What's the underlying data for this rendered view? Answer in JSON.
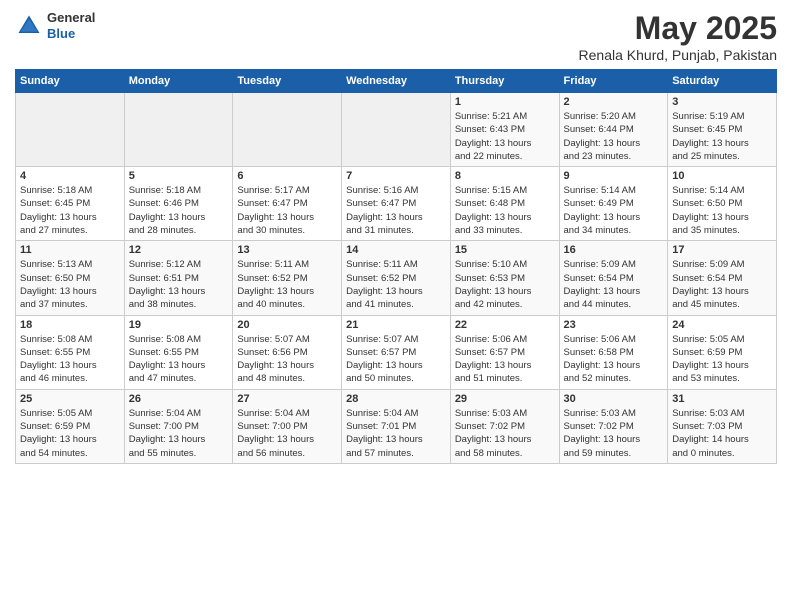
{
  "header": {
    "logo": {
      "line1": "General",
      "line2": "Blue"
    },
    "title": "May 2025",
    "subtitle": "Renala Khurd, Punjab, Pakistan"
  },
  "weekdays": [
    "Sunday",
    "Monday",
    "Tuesday",
    "Wednesday",
    "Thursday",
    "Friday",
    "Saturday"
  ],
  "weeks": [
    [
      {
        "day": "",
        "info": ""
      },
      {
        "day": "",
        "info": ""
      },
      {
        "day": "",
        "info": ""
      },
      {
        "day": "",
        "info": ""
      },
      {
        "day": "1",
        "info": "Sunrise: 5:21 AM\nSunset: 6:43 PM\nDaylight: 13 hours\nand 22 minutes."
      },
      {
        "day": "2",
        "info": "Sunrise: 5:20 AM\nSunset: 6:44 PM\nDaylight: 13 hours\nand 23 minutes."
      },
      {
        "day": "3",
        "info": "Sunrise: 5:19 AM\nSunset: 6:45 PM\nDaylight: 13 hours\nand 25 minutes."
      }
    ],
    [
      {
        "day": "4",
        "info": "Sunrise: 5:18 AM\nSunset: 6:45 PM\nDaylight: 13 hours\nand 27 minutes."
      },
      {
        "day": "5",
        "info": "Sunrise: 5:18 AM\nSunset: 6:46 PM\nDaylight: 13 hours\nand 28 minutes."
      },
      {
        "day": "6",
        "info": "Sunrise: 5:17 AM\nSunset: 6:47 PM\nDaylight: 13 hours\nand 30 minutes."
      },
      {
        "day": "7",
        "info": "Sunrise: 5:16 AM\nSunset: 6:47 PM\nDaylight: 13 hours\nand 31 minutes."
      },
      {
        "day": "8",
        "info": "Sunrise: 5:15 AM\nSunset: 6:48 PM\nDaylight: 13 hours\nand 33 minutes."
      },
      {
        "day": "9",
        "info": "Sunrise: 5:14 AM\nSunset: 6:49 PM\nDaylight: 13 hours\nand 34 minutes."
      },
      {
        "day": "10",
        "info": "Sunrise: 5:14 AM\nSunset: 6:50 PM\nDaylight: 13 hours\nand 35 minutes."
      }
    ],
    [
      {
        "day": "11",
        "info": "Sunrise: 5:13 AM\nSunset: 6:50 PM\nDaylight: 13 hours\nand 37 minutes."
      },
      {
        "day": "12",
        "info": "Sunrise: 5:12 AM\nSunset: 6:51 PM\nDaylight: 13 hours\nand 38 minutes."
      },
      {
        "day": "13",
        "info": "Sunrise: 5:11 AM\nSunset: 6:52 PM\nDaylight: 13 hours\nand 40 minutes."
      },
      {
        "day": "14",
        "info": "Sunrise: 5:11 AM\nSunset: 6:52 PM\nDaylight: 13 hours\nand 41 minutes."
      },
      {
        "day": "15",
        "info": "Sunrise: 5:10 AM\nSunset: 6:53 PM\nDaylight: 13 hours\nand 42 minutes."
      },
      {
        "day": "16",
        "info": "Sunrise: 5:09 AM\nSunset: 6:54 PM\nDaylight: 13 hours\nand 44 minutes."
      },
      {
        "day": "17",
        "info": "Sunrise: 5:09 AM\nSunset: 6:54 PM\nDaylight: 13 hours\nand 45 minutes."
      }
    ],
    [
      {
        "day": "18",
        "info": "Sunrise: 5:08 AM\nSunset: 6:55 PM\nDaylight: 13 hours\nand 46 minutes."
      },
      {
        "day": "19",
        "info": "Sunrise: 5:08 AM\nSunset: 6:55 PM\nDaylight: 13 hours\nand 47 minutes."
      },
      {
        "day": "20",
        "info": "Sunrise: 5:07 AM\nSunset: 6:56 PM\nDaylight: 13 hours\nand 48 minutes."
      },
      {
        "day": "21",
        "info": "Sunrise: 5:07 AM\nSunset: 6:57 PM\nDaylight: 13 hours\nand 50 minutes."
      },
      {
        "day": "22",
        "info": "Sunrise: 5:06 AM\nSunset: 6:57 PM\nDaylight: 13 hours\nand 51 minutes."
      },
      {
        "day": "23",
        "info": "Sunrise: 5:06 AM\nSunset: 6:58 PM\nDaylight: 13 hours\nand 52 minutes."
      },
      {
        "day": "24",
        "info": "Sunrise: 5:05 AM\nSunset: 6:59 PM\nDaylight: 13 hours\nand 53 minutes."
      }
    ],
    [
      {
        "day": "25",
        "info": "Sunrise: 5:05 AM\nSunset: 6:59 PM\nDaylight: 13 hours\nand 54 minutes."
      },
      {
        "day": "26",
        "info": "Sunrise: 5:04 AM\nSunset: 7:00 PM\nDaylight: 13 hours\nand 55 minutes."
      },
      {
        "day": "27",
        "info": "Sunrise: 5:04 AM\nSunset: 7:00 PM\nDaylight: 13 hours\nand 56 minutes."
      },
      {
        "day": "28",
        "info": "Sunrise: 5:04 AM\nSunset: 7:01 PM\nDaylight: 13 hours\nand 57 minutes."
      },
      {
        "day": "29",
        "info": "Sunrise: 5:03 AM\nSunset: 7:02 PM\nDaylight: 13 hours\nand 58 minutes."
      },
      {
        "day": "30",
        "info": "Sunrise: 5:03 AM\nSunset: 7:02 PM\nDaylight: 13 hours\nand 59 minutes."
      },
      {
        "day": "31",
        "info": "Sunrise: 5:03 AM\nSunset: 7:03 PM\nDaylight: 14 hours\nand 0 minutes."
      }
    ]
  ]
}
